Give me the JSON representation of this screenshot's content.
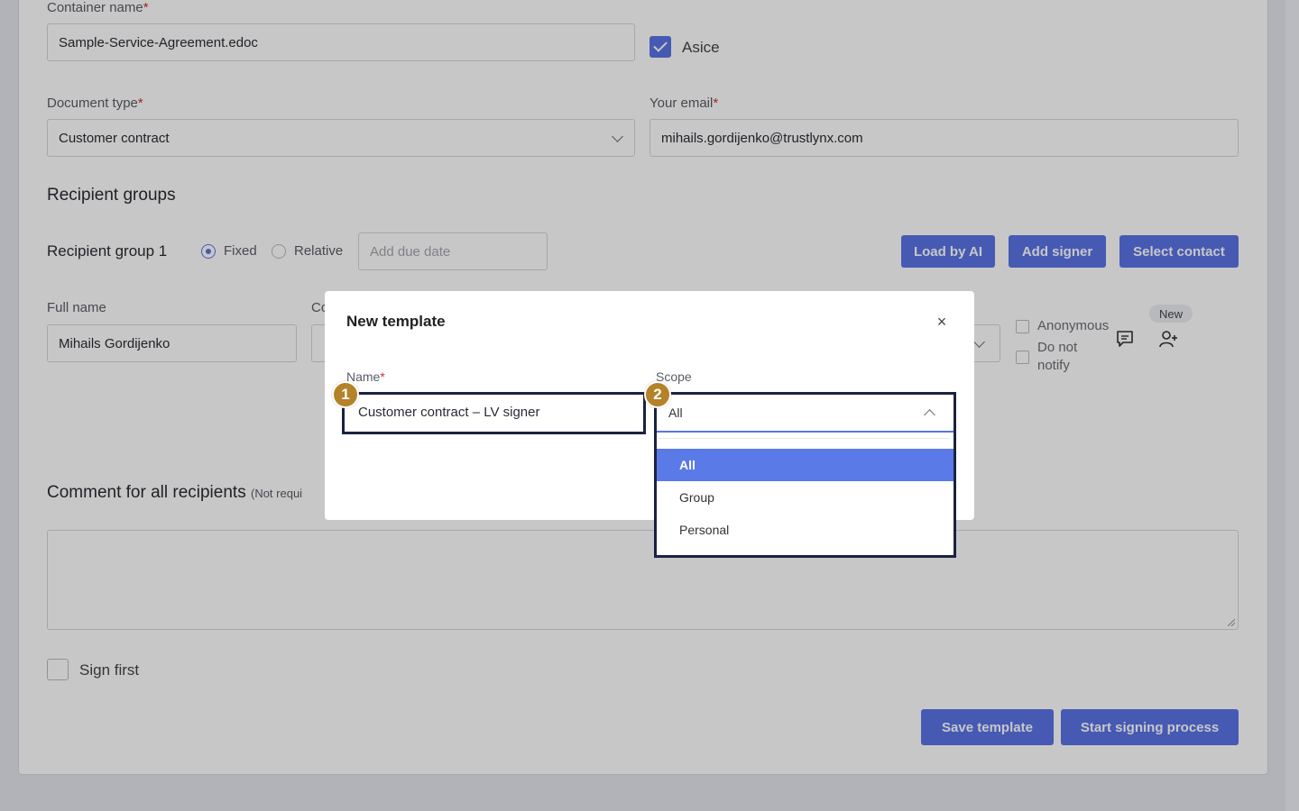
{
  "form": {
    "container_name_label": "Container name",
    "required_mark": "*",
    "container_name_value": "Sample-Service-Agreement.edoc",
    "asice_label": "Asice",
    "document_type_label": "Document type",
    "document_type_value": "Customer contract",
    "email_label": "Your email",
    "email_value": "mihails.gordijenko@trustlynx.com",
    "recipient_groups_title": "Recipient groups",
    "group1_label": "Recipient group 1",
    "fixed_label": "Fixed",
    "relative_label": "Relative",
    "due_date_placeholder": "Add due date",
    "load_by_ai": "Load by AI",
    "add_signer": "Add signer",
    "select_contact": "Select contact",
    "full_name_label": "Full name",
    "col2_label_partial": "Co",
    "full_name_value": "Mihails Gordijenko",
    "anonymous_label": "Anonymous",
    "do_not_notify_label_1": "Do not",
    "do_not_notify_label_2": "notify",
    "new_badge": "New",
    "comment_title": "Comment for all recipients",
    "comment_note": "(Not requi",
    "sign_first_label": "Sign first",
    "save_template": "Save template",
    "start_signing": "Start signing process"
  },
  "modal": {
    "title": "New template",
    "close": "×",
    "name_label": "Name",
    "name_value": "Customer contract – LV signer",
    "scope_label": "Scope",
    "scope_value": "All",
    "scope_options": [
      "All",
      "Group",
      "Personal"
    ],
    "selected_option": "All"
  },
  "markers": [
    "1",
    "2"
  ],
  "colors": {
    "accent": "#5a74e6",
    "marker": "#b5822a",
    "highlight_border": "#1b2240",
    "required": "#d0312d"
  }
}
